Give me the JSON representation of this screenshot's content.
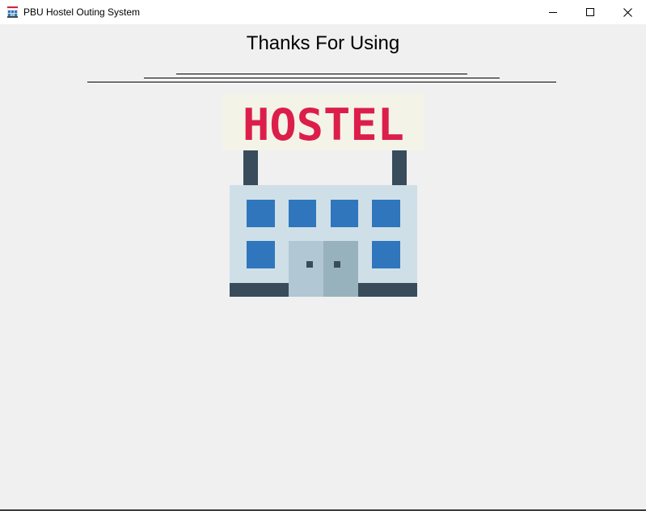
{
  "window": {
    "title": "PBU Hostel Outing System",
    "app_icon": "hostel-building-icon",
    "controls": {
      "minimize_icon": "minimize-icon",
      "maximize_icon": "maximize-icon",
      "close_icon": "close-icon"
    }
  },
  "main": {
    "heading": "Thanks For Using",
    "logo": {
      "sign_text": "HOSTEL",
      "icon": "hostel-building-icon"
    }
  },
  "colors": {
    "background": "#f0f0f0",
    "titlebar": "#ffffff",
    "sign_text": "#dc1e4a",
    "sign_board": "#f4f3e8",
    "building_wall": "#cfdfe8",
    "window_blue": "#2f76bd",
    "dark_slate": "#384c5c",
    "door_left": "#b1c7d3",
    "door_right": "#97b2bd"
  }
}
